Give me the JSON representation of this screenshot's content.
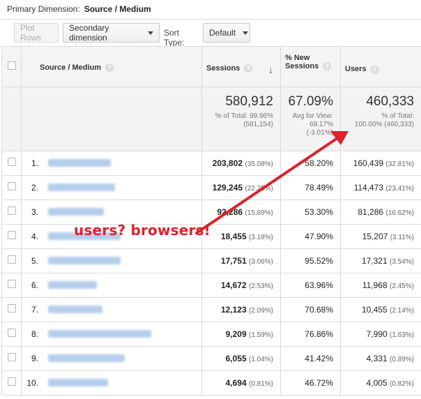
{
  "primary_dimension": {
    "label": "Primary Dimension:",
    "value": "Source / Medium"
  },
  "toolbar": {
    "plot_rows": "Plot Rows",
    "secondary_dimension": "Secondary dimension",
    "sort_type_label": "Sort Type:",
    "sort_type_value": "Default"
  },
  "table": {
    "headers": {
      "source_medium": "Source / Medium",
      "sessions": "Sessions",
      "new_sessions": "% New Sessions",
      "users": "Users"
    },
    "totals": {
      "sessions": "580,912",
      "sessions_sub1": "% of Total: 99.96%",
      "sessions_sub2": "(581,154)",
      "new_sessions": "67.09%",
      "new_sessions_sub1": "Avg for View:",
      "new_sessions_sub2": "69.17%",
      "new_sessions_sub3": "(-3.01%)",
      "users": "460,333",
      "users_sub1": "% of Total:",
      "users_sub2": "100.00% (460,333)"
    },
    "rows": [
      {
        "idx": "1.",
        "sessions": "203,802",
        "sessions_pct": "(35.08%)",
        "new_sessions": "58.20%",
        "users": "160,439",
        "users_pct": "(32.81%)"
      },
      {
        "idx": "2.",
        "sessions": "129,245",
        "sessions_pct": "(22.25%)",
        "new_sessions": "78.49%",
        "users": "114,473",
        "users_pct": "(23.41%)"
      },
      {
        "idx": "3.",
        "sessions": "92,286",
        "sessions_pct": "(15.89%)",
        "new_sessions": "53.30%",
        "users": "81,286",
        "users_pct": "(16.62%)"
      },
      {
        "idx": "4.",
        "sessions": "18,455",
        "sessions_pct": "(3.18%)",
        "new_sessions": "47.90%",
        "users": "15,207",
        "users_pct": "(3.11%)"
      },
      {
        "idx": "5.",
        "sessions": "17,751",
        "sessions_pct": "(3.06%)",
        "new_sessions": "95.52%",
        "users": "17,321",
        "users_pct": "(3.54%)"
      },
      {
        "idx": "6.",
        "sessions": "14,672",
        "sessions_pct": "(2.53%)",
        "new_sessions": "63.96%",
        "users": "11,968",
        "users_pct": "(2.45%)"
      },
      {
        "idx": "7.",
        "sessions": "12,123",
        "sessions_pct": "(2.09%)",
        "new_sessions": "70.68%",
        "users": "10,455",
        "users_pct": "(2.14%)"
      },
      {
        "idx": "8.",
        "sessions": "9,209",
        "sessions_pct": "(1.59%)",
        "new_sessions": "76.86%",
        "users": "7,990",
        "users_pct": "(1.63%)"
      },
      {
        "idx": "9.",
        "sessions": "6,055",
        "sessions_pct": "(1.04%)",
        "new_sessions": "41.42%",
        "users": "4,331",
        "users_pct": "(0.89%)"
      },
      {
        "idx": "10.",
        "sessions": "4,694",
        "sessions_pct": "(0.81%)",
        "new_sessions": "46.72%",
        "users": "4,005",
        "users_pct": "(0.82%)"
      }
    ]
  },
  "annotation": {
    "text": "users? browsers!",
    "color": "#e0202b"
  },
  "colors": {
    "blurred_source_text": "#a9c6e8",
    "header_bg": "#f4f4f4",
    "border": "#dadada"
  }
}
